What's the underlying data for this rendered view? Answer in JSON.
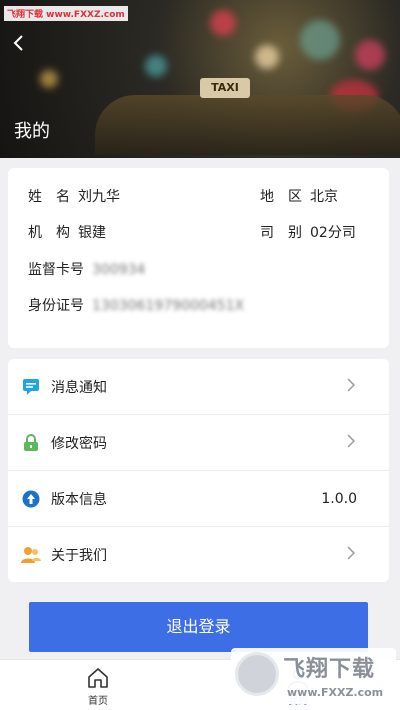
{
  "watermark": {
    "top_text": "飞翔下载 www.FXXZ.com",
    "brand": "飞翔下载",
    "url": "www.FXXZ.com"
  },
  "header": {
    "title": "我的",
    "taxi_sign": "TAXI"
  },
  "profile": {
    "name_label": "姓　名",
    "name_value": "刘九华",
    "region_label": "地　区",
    "region_value": "北京",
    "org_label": "机　构",
    "org_value": "银建",
    "branch_label": "司　别",
    "branch_value": "02分司",
    "card_label": "监督卡号",
    "card_value": "300934",
    "id_label": "身份证号",
    "id_value": "1303061979000451X"
  },
  "menu": {
    "messages": "消息通知",
    "password": "修改密码",
    "version": "版本信息",
    "version_value": "1.0.0",
    "about": "关于我们"
  },
  "logout_label": "退出登录",
  "nav": {
    "home": "首页",
    "mine": "我的"
  },
  "colors": {
    "accent": "#3e6ee5",
    "msg_icon": "#1ea6e0",
    "lock_icon": "#5cb85c",
    "version_icon": "#1a73c8",
    "about_icon": "#f0a030"
  }
}
